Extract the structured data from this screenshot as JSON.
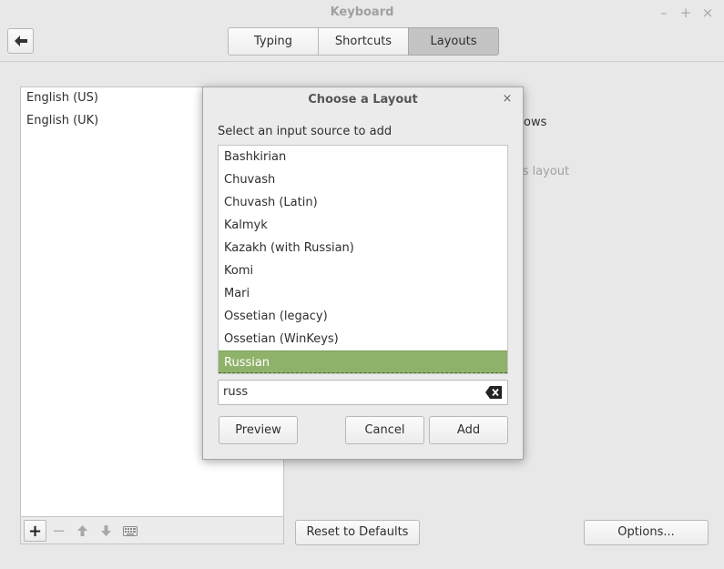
{
  "window": {
    "title": "Keyboard",
    "controls": {
      "minimize": "–",
      "maximize": "+",
      "close": "×"
    }
  },
  "toolbar": {
    "tabs": [
      {
        "label": "Typing"
      },
      {
        "label": "Shortcuts"
      },
      {
        "label": "Layouts",
        "active": true
      }
    ]
  },
  "layouts": {
    "items": [
      {
        "label": "English (US)"
      },
      {
        "label": "English (UK)"
      }
    ],
    "toolbar_icons": [
      "add-icon",
      "remove-icon",
      "move-up-icon",
      "move-down-icon",
      "keyboard-icon"
    ],
    "toolbar_glyphs": {
      "add": "+",
      "remove": "−"
    }
  },
  "background_text": {
    "line1": "ows",
    "line2": "'s layout"
  },
  "footer": {
    "reset_label": "Reset to Defaults",
    "options_label": "Options..."
  },
  "dialog": {
    "title": "Choose a Layout",
    "close_glyph": "×",
    "prompt": "Select an input source to add",
    "sources": [
      {
        "label": "Bashkirian"
      },
      {
        "label": "Chuvash"
      },
      {
        "label": "Chuvash (Latin)"
      },
      {
        "label": "Kalmyk"
      },
      {
        "label": "Kazakh (with Russian)"
      },
      {
        "label": "Komi"
      },
      {
        "label": "Mari"
      },
      {
        "label": "Ossetian (legacy)"
      },
      {
        "label": "Ossetian (WinKeys)"
      },
      {
        "label": "Russian",
        "selected": true
      }
    ],
    "search_value": "russ",
    "preview_label": "Preview",
    "cancel_label": "Cancel",
    "add_label": "Add"
  },
  "colors": {
    "selection": "#8fb26a",
    "active_tab": "#c4c4c4"
  }
}
